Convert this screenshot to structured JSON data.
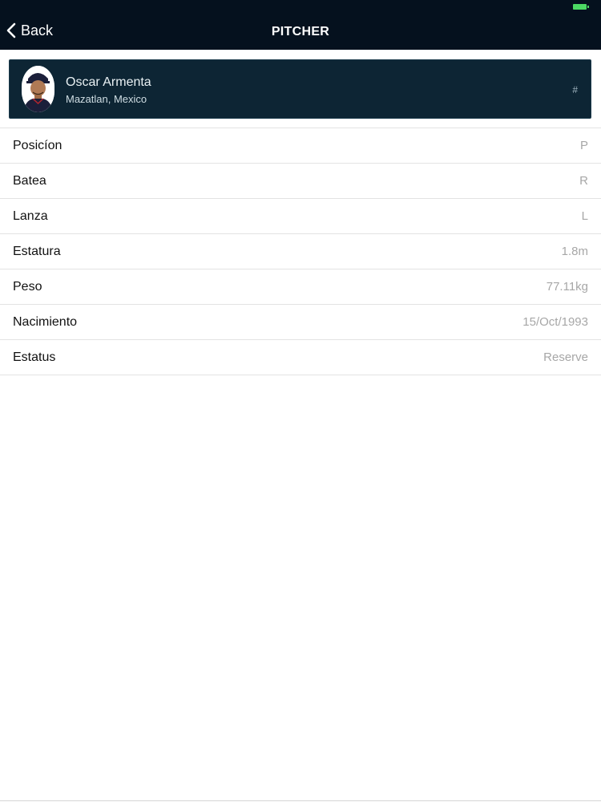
{
  "nav": {
    "back_label": "Back",
    "title": "PITCHER"
  },
  "player": {
    "name": "Oscar Armenta",
    "origin": "Mazatlan, Mexico",
    "number": "#"
  },
  "details": [
    {
      "label": "Posicíon",
      "value": "P"
    },
    {
      "label": "Batea",
      "value": "R"
    },
    {
      "label": "Lanza",
      "value": "L"
    },
    {
      "label": "Estatura",
      "value": "1.8m"
    },
    {
      "label": "Peso",
      "value": "77.11kg"
    },
    {
      "label": "Nacimiento",
      "value": "15/Oct/1993"
    },
    {
      "label": "Estatus",
      "value": "Reserve"
    }
  ],
  "colors": {
    "header_bg": "#05111e",
    "card_bg": "#0d2534",
    "battery": "#4cd964"
  },
  "icons": {
    "back": "chevron-left-icon",
    "battery": "battery-icon",
    "avatar": "player-photo"
  }
}
